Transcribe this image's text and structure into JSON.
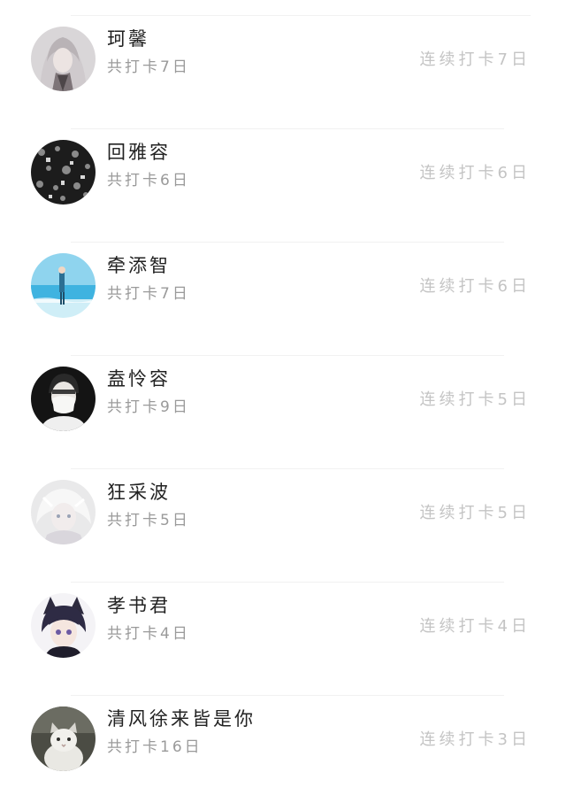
{
  "colors": {
    "name": "#222222",
    "secondary": "#9a9a9a",
    "streak": "#c4c4c4",
    "divider": "#f1f1f1"
  },
  "entries": [
    {
      "name": "珂馨",
      "total": "共打卡7日",
      "streak": "连续打卡7日",
      "avatar": "avatar-silver-hair-girl"
    },
    {
      "name": "回雅容",
      "total": "共打卡6日",
      "streak": "连续打卡6日",
      "avatar": "avatar-black-pattern"
    },
    {
      "name": "牵添智",
      "total": "共打卡7日",
      "streak": "连续打卡6日",
      "avatar": "avatar-beach-figure"
    },
    {
      "name": "盍怜容",
      "total": "共打卡9日",
      "streak": "连续打卡5日",
      "avatar": "avatar-masked-person"
    },
    {
      "name": "狂采波",
      "total": "共打卡5日",
      "streak": "连续打卡5日",
      "avatar": "avatar-white-hair-anime"
    },
    {
      "name": "孝书君",
      "total": "共打卡4日",
      "streak": "连续打卡4日",
      "avatar": "avatar-anime-cat-ears"
    },
    {
      "name": "清风徐来皆是你",
      "total": "共打卡16日",
      "streak": "连续打卡3日",
      "avatar": "avatar-white-cat"
    }
  ]
}
